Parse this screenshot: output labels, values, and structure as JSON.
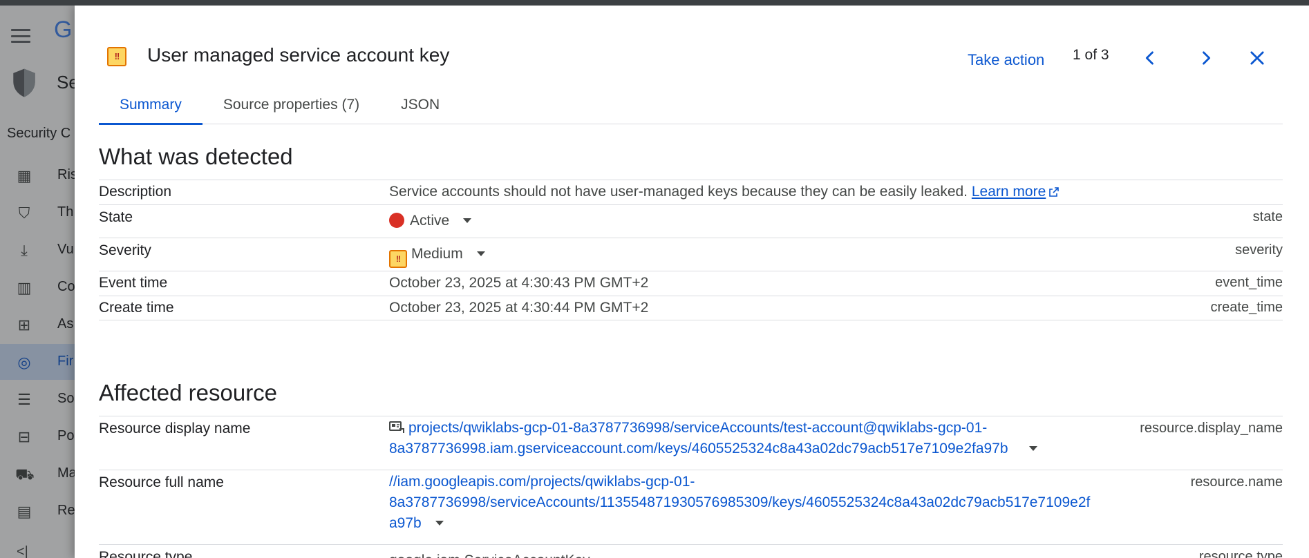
{
  "background_app": {
    "logo_text": "G",
    "product_text": "Se",
    "section_text": "Security C",
    "nav_items": [
      {
        "label": "Ris",
        "icon": "dashboard-icon"
      },
      {
        "label": "Th",
        "icon": "shield-outline-icon"
      },
      {
        "label": "Vu",
        "icon": "download-icon"
      },
      {
        "label": "Co",
        "icon": "compliance-icon"
      },
      {
        "label": "As",
        "icon": "asset-tree-icon"
      },
      {
        "label": "Fir",
        "icon": "findings-icon",
        "active": true
      },
      {
        "label": "So",
        "icon": "list-icon"
      },
      {
        "label": "Po",
        "icon": "posture-icon"
      },
      {
        "label": "Ma",
        "icon": "marketplace-cart-icon"
      },
      {
        "label": "Re",
        "icon": "report-icon"
      }
    ],
    "collapse_label": "<|"
  },
  "panel": {
    "title": "User managed service account key",
    "severity_badge": "!!",
    "take_action": "Take action",
    "pager": "1 of 3",
    "tabs": [
      "Summary",
      "Source properties (7)",
      "JSON"
    ],
    "active_tab": 0
  },
  "detected": {
    "heading": "What was detected",
    "description_label": "Description",
    "description_text": "Service accounts should not have user-managed keys because they can be easily leaked.",
    "learn_more": "Learn more",
    "state_label": "State",
    "state_value": "Active",
    "state_key": "state",
    "severity_label": "Severity",
    "severity_value": "Medium",
    "severity_key": "severity",
    "event_time_label": "Event time",
    "event_time_value": "October 23, 2025 at 4:30:43 PM GMT+2",
    "event_time_key": "event_time",
    "create_time_label": "Create time",
    "create_time_value": "October 23, 2025 at 4:30:44 PM GMT+2",
    "create_time_key": "create_time"
  },
  "resource": {
    "heading": "Affected resource",
    "display_name_label": "Resource display name",
    "display_name_line1": "projects/qwiklabs-gcp-01-8a3787736998/serviceAccounts/test-account@qwiklabs-gcp-01-",
    "display_name_line2": "8a3787736998.iam.gserviceaccount.com/keys/4605525324c8a43a02dc79acb517e7109e2fa97b",
    "display_name_key": "resource.display_name",
    "full_name_label": "Resource full name",
    "full_name_line1": "//iam.googleapis.com/projects/qwiklabs-gcp-01-",
    "full_name_line2": "8a3787736998/serviceAccounts/113554871930576985309/keys/4605525324c8a43a02dc79acb517e7109e2f",
    "full_name_line3": "a97b",
    "full_name_key": "resource.name",
    "type_label": "Resource type",
    "type_value": "google.iam.ServiceAccountKey",
    "type_key": "resource.type"
  },
  "colors": {
    "accent": "#0b57d0",
    "active_dot": "#d93025",
    "severity_fill": "#fdd663",
    "severity_border": "#e37400"
  }
}
